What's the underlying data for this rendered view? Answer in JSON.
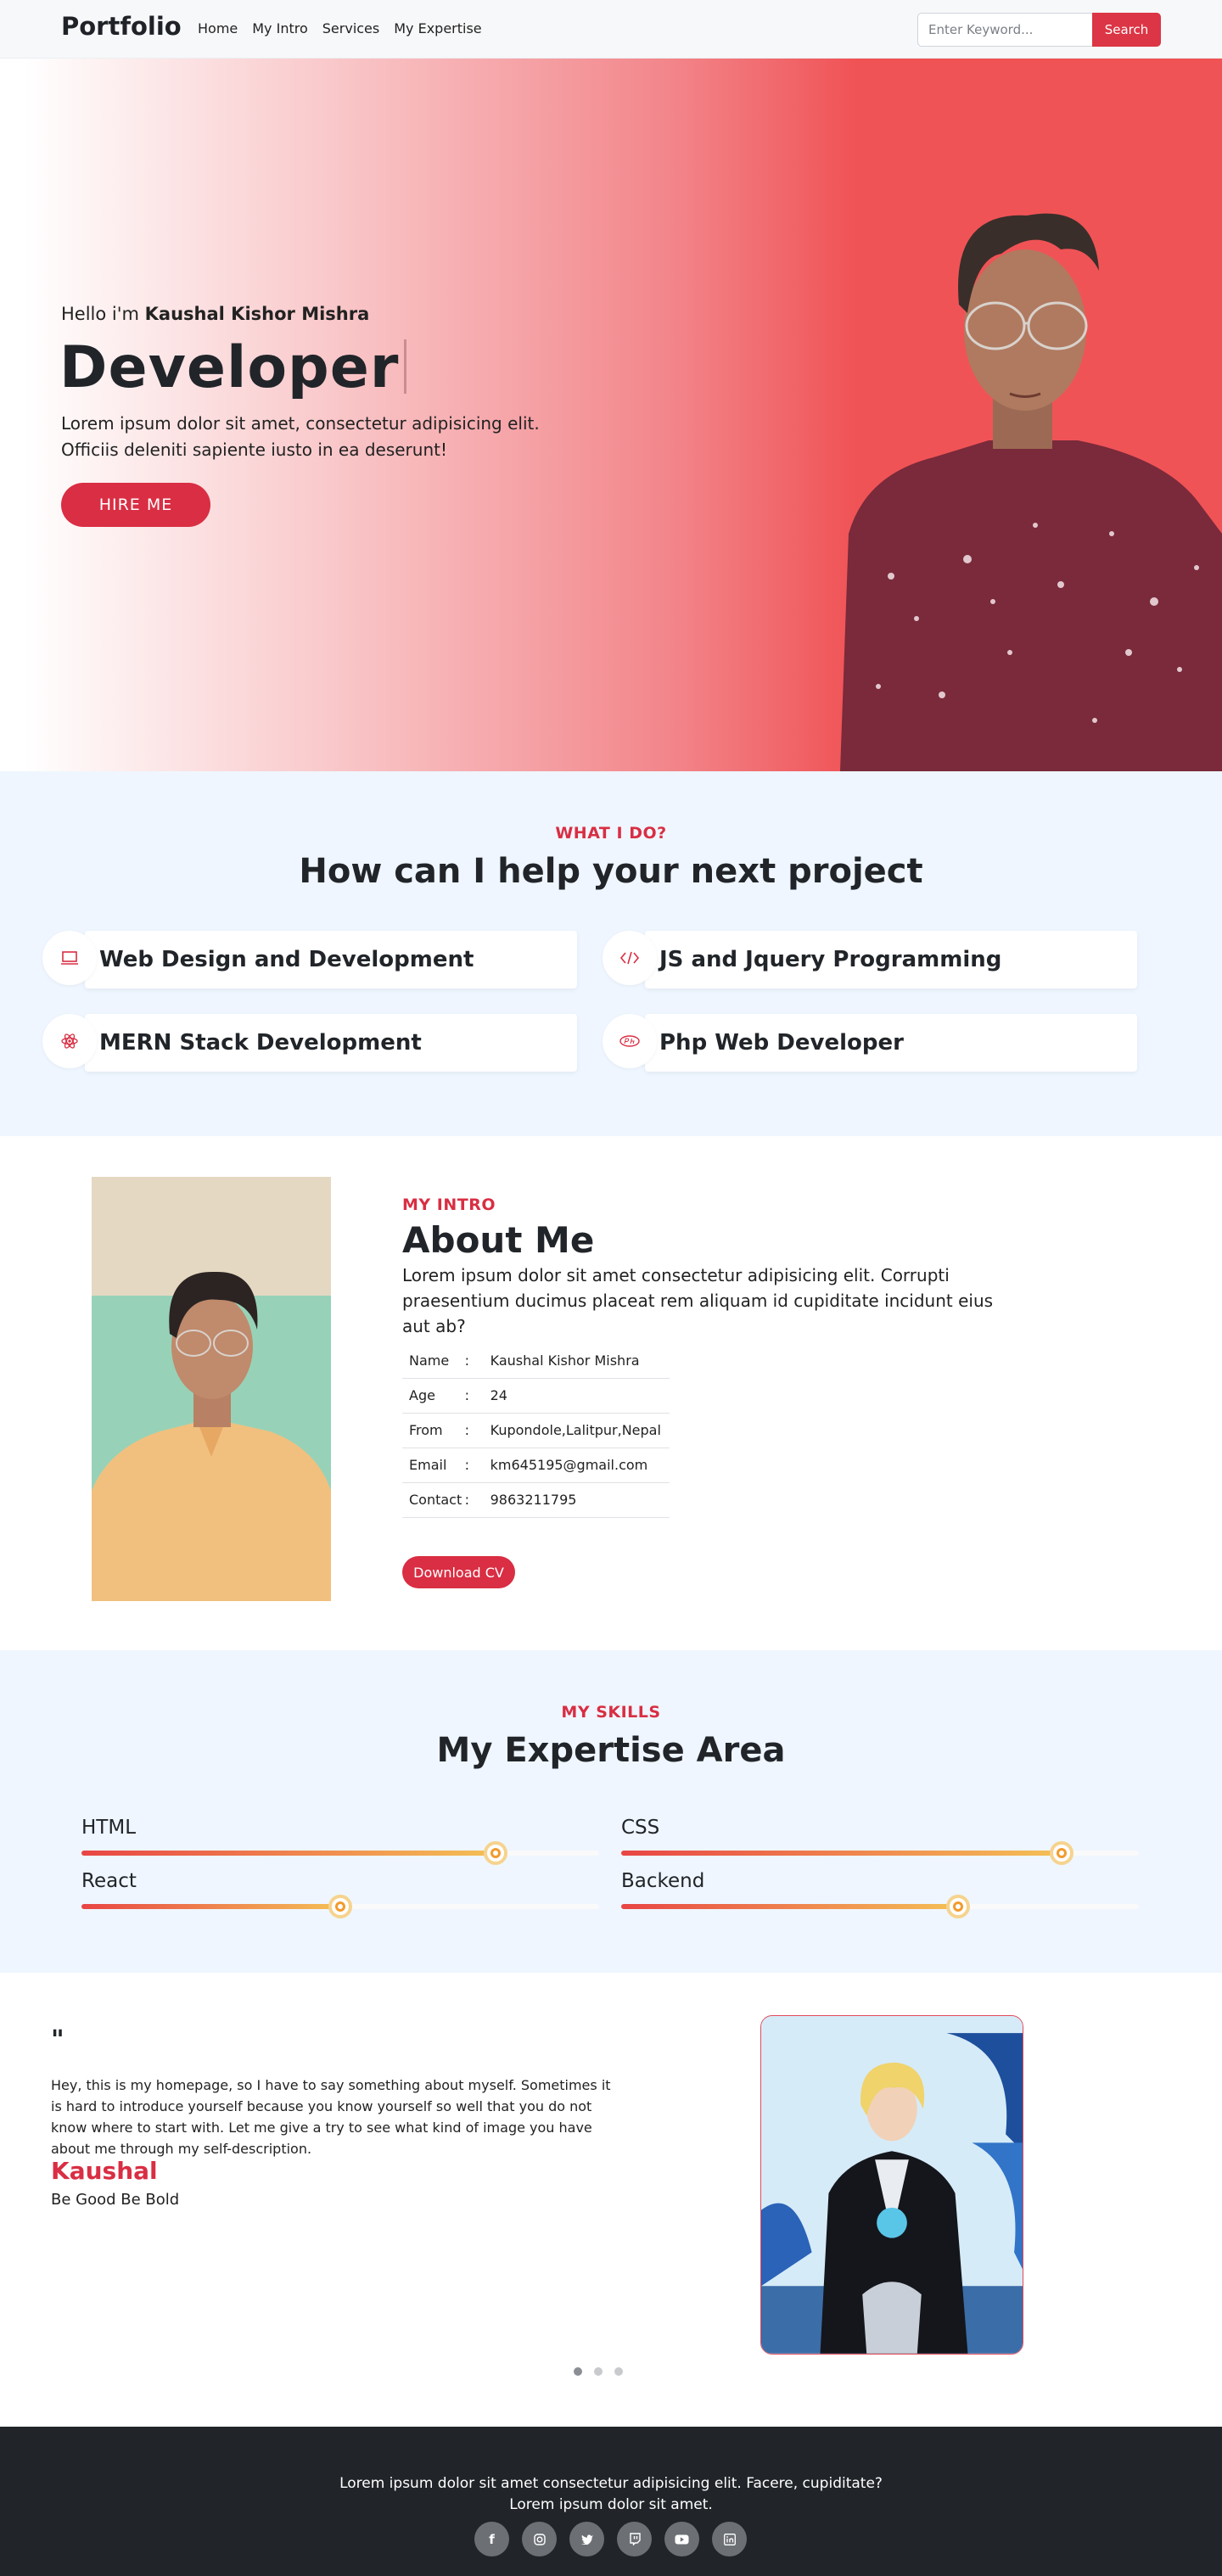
{
  "nav": {
    "brand": "Portfolio",
    "links": [
      "Home",
      "My Intro",
      "Services",
      "My Expertise"
    ],
    "search_placeholder": "Enter Keyword...",
    "search_button": "Search"
  },
  "hero": {
    "greeting": "Hello i'm",
    "name": "Kaushal Kishor Mishra",
    "role": "Developer",
    "description": "Lorem ipsum dolor sit amet, consectetur adipisicing elit. Officiis deleniti sapiente iusto in ea deserunt!",
    "cta": "HIRE ME"
  },
  "services": {
    "kicker": "WHAT I DO?",
    "title": "How can I help your next project",
    "items": [
      {
        "label": "Web Design and Development",
        "icon": "laptop-icon"
      },
      {
        "label": "JS and Jquery Programming",
        "icon": "code-icon"
      },
      {
        "label": "MERN Stack Development",
        "icon": "react-icon"
      },
      {
        "label": "Php Web Developer",
        "icon": "php-icon"
      }
    ]
  },
  "about": {
    "kicker": "MY INTRO",
    "title": "About Me",
    "description": "Lorem ipsum dolor sit amet consectetur adipisicing elit. Corrupti praesentium ducimus placeat rem aliquam id cupiditate incidunt eius aut ab?",
    "rows": [
      {
        "label": "Name",
        "sep": ":",
        "value": "Kaushal Kishor Mishra"
      },
      {
        "label": "Age",
        "sep": ":",
        "value": "24"
      },
      {
        "label": "From",
        "sep": ":",
        "value": "Kupondole,Lalitpur,Nepal"
      },
      {
        "label": "Email",
        "sep": ":",
        "value": "km645195@gmail.com"
      },
      {
        "label": "Contact",
        "sep": ":",
        "value": "9863211795"
      }
    ],
    "download": "Download CV"
  },
  "skills": {
    "kicker": "MY SKILLS",
    "title": "My Expertise Area",
    "items": [
      {
        "name": "HTML",
        "level": 0.8
      },
      {
        "name": "CSS",
        "level": 0.85
      },
      {
        "name": "React",
        "level": 0.5
      },
      {
        "name": "Backend",
        "level": 0.65
      }
    ]
  },
  "testimonial": {
    "quote_mark": "\"",
    "text": "Hey, this is my homepage, so I have to say something about myself. Sometimes it is hard to introduce yourself because you know yourself so well that you do not know where to start with. Let me give a try to see what kind of image you have about me through my self-description.",
    "name": "Kaushal",
    "tagline": "Be Good Be Bold",
    "active_slide": 1
  },
  "footer": {
    "line1": "Lorem ipsum dolor sit amet consectetur adipisicing elit. Facere, cupiditate?",
    "line2": "Lorem ipsum dolor sit amet.",
    "social": [
      "facebook-icon",
      "instagram-icon",
      "twitter-icon",
      "twitch-icon",
      "youtube-icon",
      "linkedin-icon"
    ]
  },
  "colors": {
    "accent": "#dc3545",
    "hero_red": "#f05356",
    "section_bg": "#eff6ff",
    "footer_bg": "#212529"
  }
}
